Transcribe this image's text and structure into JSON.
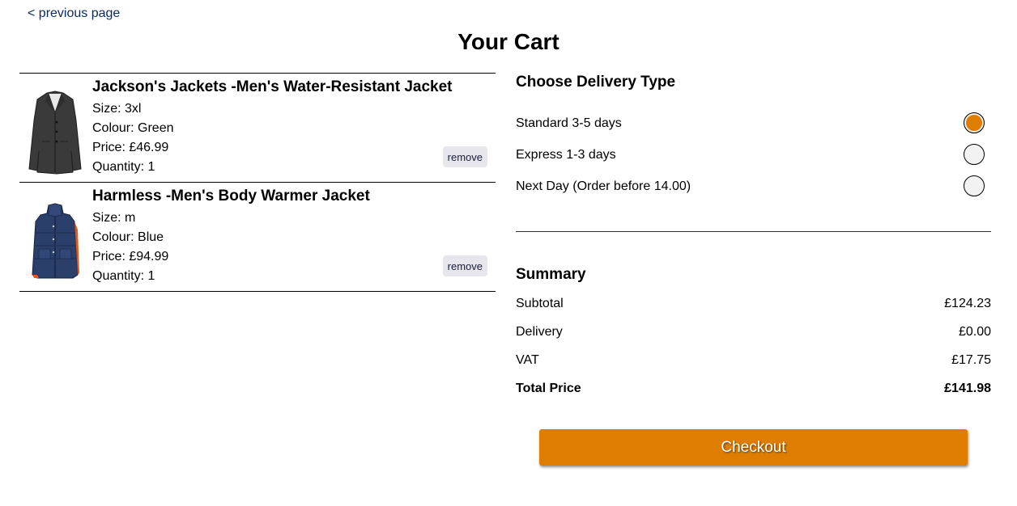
{
  "nav": {
    "previous_label": "< previous page"
  },
  "page_title": "Your Cart",
  "cart": {
    "items": [
      {
        "name": "Jackson's Jackets -Men's Water-Resistant Jacket",
        "size": "Size: 3xl",
        "colour": "Colour: Green",
        "price": "Price: £46.99",
        "quantity": "Quantity: 1",
        "image_icon": "coat-image",
        "remove_label": "remove"
      },
      {
        "name": "Harmless -Men's Body Warmer Jacket",
        "size": "Size: m",
        "colour": "Colour: Blue",
        "price": "Price: £94.99",
        "quantity": "Quantity: 1",
        "image_icon": "vest-image",
        "remove_label": "remove"
      }
    ]
  },
  "delivery": {
    "heading": "Choose Delivery Type",
    "options": [
      {
        "label": "Standard 3-5 days",
        "selected": true
      },
      {
        "label": "Express 1-3 days",
        "selected": false
      },
      {
        "label": "Next Day (Order before 14.00)",
        "selected": false
      }
    ]
  },
  "summary": {
    "heading": "Summary",
    "subtotal_label": "Subtotal",
    "subtotal_value": "£124.23",
    "delivery_label": "Delivery",
    "delivery_value": "£0.00",
    "vat_label": "VAT",
    "vat_value": "£17.75",
    "total_label": "Total Price",
    "total_value": "£141.98"
  },
  "checkout_label": "Checkout",
  "colors": {
    "accent": "#de7d00",
    "link": "#0b2a5c",
    "remove_bg": "#e6e6ec"
  }
}
